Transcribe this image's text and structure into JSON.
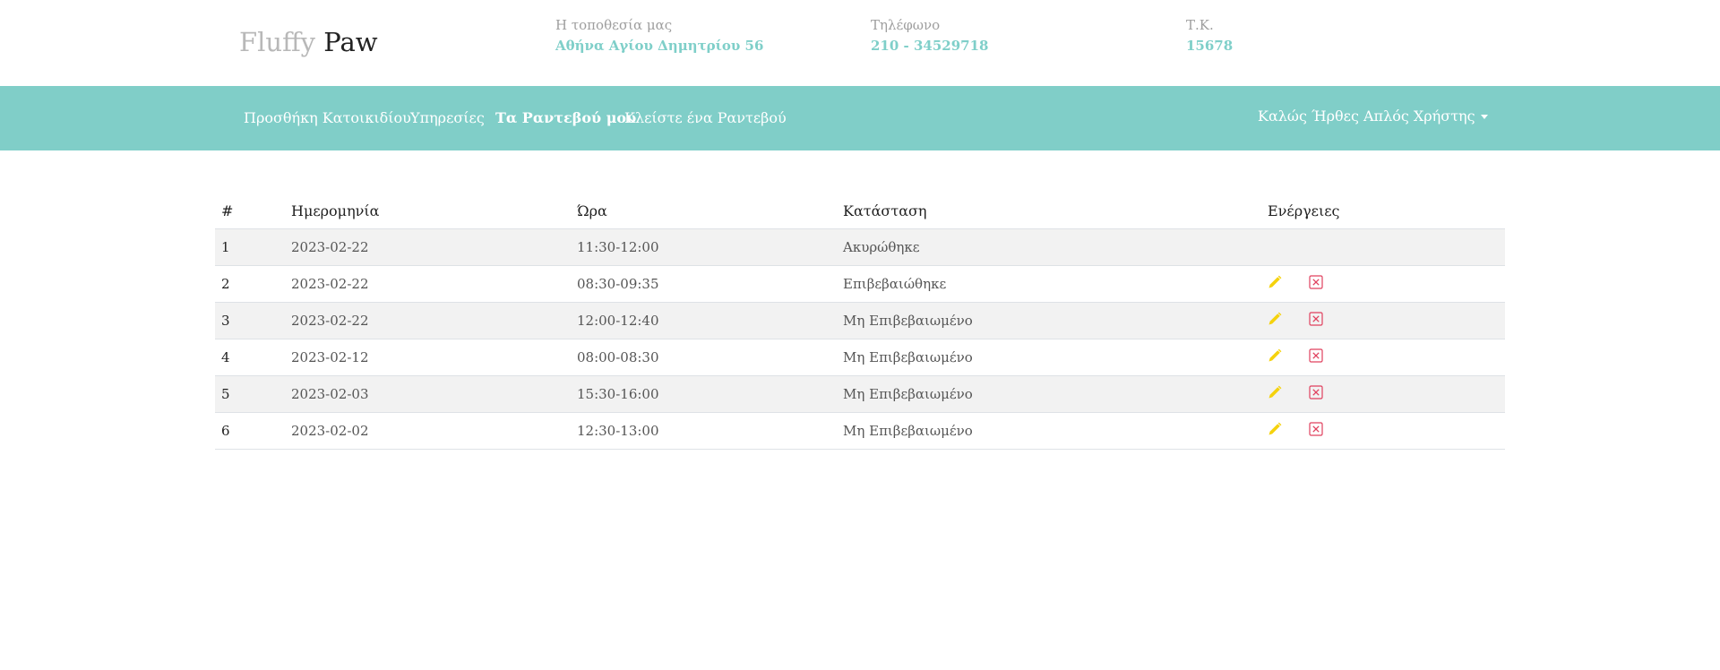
{
  "brand": {
    "first": "Fluffy",
    "second": "Paw"
  },
  "info": [
    {
      "label": "Η τοποθεσία μας",
      "value": "Αθήνα Αγίου Δημητρίου 56"
    },
    {
      "label": "Τηλέφωνο",
      "value": "210 - 34529718"
    },
    {
      "label": "Τ.Κ.",
      "value": "15678"
    }
  ],
  "nav": {
    "items": [
      {
        "label": "Προσθήκη Κατοικιδίου"
      },
      {
        "label": "Υπηρεσίες"
      },
      {
        "label": "Τα Ραντεβού μου"
      },
      {
        "label": "Κλείστε ένα Ραντεβού"
      }
    ],
    "active": "Τα Ραντεβού μου",
    "user": "Καλώς Ήρθες Απλός Χρήστης"
  },
  "table": {
    "headers": [
      "#",
      "Ημερομηνία",
      "Ώρα",
      "Κατάσταση",
      "Ενέργειες"
    ],
    "rows": [
      {
        "id": "1",
        "date": "2023-02-22",
        "time": "11:30-12:00",
        "status": "Ακυρώθηκε",
        "actions": false
      },
      {
        "id": "2",
        "date": "2023-02-22",
        "time": "08:30-09:35",
        "status": "Επιβεβαιώθηκε",
        "actions": true
      },
      {
        "id": "3",
        "date": "2023-02-22",
        "time": "12:00-12:40",
        "status": "Μη Επιβεβαιωμένο",
        "actions": true
      },
      {
        "id": "4",
        "date": "2023-02-12",
        "time": "08:00-08:30",
        "status": "Μη Επιβεβαιωμένο",
        "actions": true
      },
      {
        "id": "5",
        "date": "2023-02-03",
        "time": "15:30-16:00",
        "status": "Μη Επιβεβαιωμένο",
        "actions": true
      },
      {
        "id": "6",
        "date": "2023-02-02",
        "time": "12:30-13:00",
        "status": "Μη Επιβεβαιωμένο",
        "actions": true
      }
    ],
    "icons": {
      "edit": "pencil-icon",
      "delete": "close-box-icon"
    }
  },
  "colors": {
    "accent": "#80cec8",
    "edit": "#f5d20d",
    "delete": "#e0405e",
    "stripe": "#f2f2f2"
  }
}
